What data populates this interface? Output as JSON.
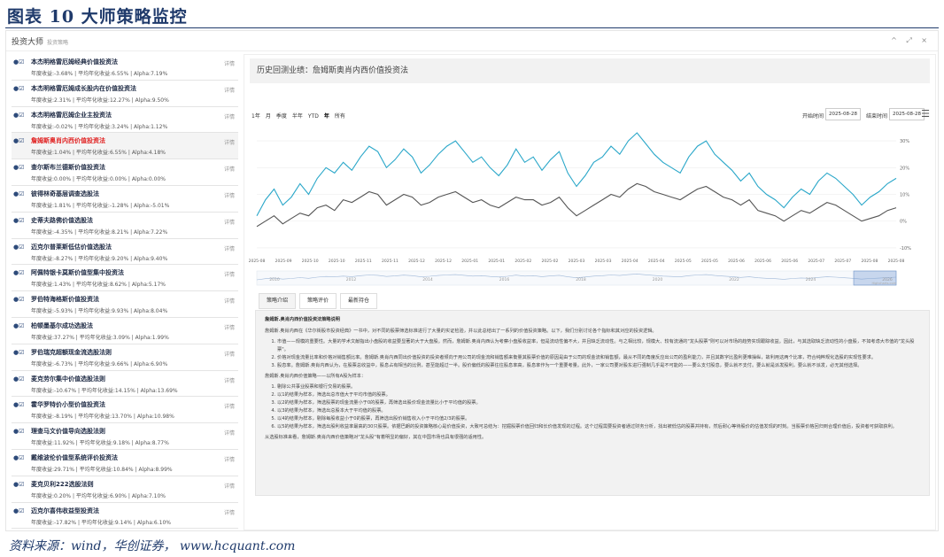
{
  "figure": {
    "title": "图表 10   大师策略监控",
    "source": "资料来源：wind，华创证券，  www.hcquant.com"
  },
  "app": {
    "name": "投资大师",
    "subtitle": "投资策略",
    "controls": "^ ⤢ ×"
  },
  "sidebar": {
    "action_label": "详情",
    "items": [
      {
        "name": "本杰明格雷厄姆经典价值投资法",
        "stats": "年度收益:-3.68% | 平均年化收益:6.55% | Alpha:7.19%"
      },
      {
        "name": "本杰明格雷厄姆成长股内在价值投资法",
        "stats": "年度收益:2.31% | 平均年化收益:12.27% | Alpha:9.50%"
      },
      {
        "name": "本杰明格雷厄姆企业主投资法",
        "stats": "年度收益:-0.02% | 平均年化收益:3.24% | Alpha:1.12%"
      },
      {
        "name": "詹姆斯奥肖内西价值投资法",
        "stats": "年度收益:1.04% | 平均年化收益:6.55% | Alpha:4.18%",
        "selected": true
      },
      {
        "name": "查尔斯布兰德斯价值投资法",
        "stats": "年度收益:0.00% | 平均年化收益:0.00% | Alpha:0.00%"
      },
      {
        "name": "彼得林奇基层调查选股法",
        "stats": "年度收益:1.81% | 平均年化收益:-1.28% | Alpha:-5.01%"
      },
      {
        "name": "史蒂夫路佛价值选股法",
        "stats": "年度收益:-4.35% | 平均年化收益:8.21% | Alpha:7.22%"
      },
      {
        "name": "迈克尔普莱斯低估价值选股法",
        "stats": "年度收益:-8.27% | 平均年化收益:9.20% | Alpha:9.40%"
      },
      {
        "name": "阿佩特银卡莫斯价值型集中投资法",
        "stats": "年度收益:1.43% | 平均年化收益:8.62% | Alpha:5.17%"
      },
      {
        "name": "罗伯特海格斯价值投资法",
        "stats": "年度收益:-5.93% | 平均年化收益:9.93% | Alpha:8.04%"
      },
      {
        "name": "柏顿墨基尔成功选股法",
        "stats": "年度收益:37.27% | 平均年化收益:3.09% | Alpha:1.99%"
      },
      {
        "name": "罗伯瑞克超额现金流选股法则",
        "stats": "年度收益:-6.73% | 平均年化收益:9.66% | Alpha:6.90%"
      },
      {
        "name": "麦克劳尔集中价值选股法则",
        "stats": "年度收益:-10.67% | 平均年化收益:14.15% | Alpha:13.69%"
      },
      {
        "name": "霍华罗特价小型价值投资法",
        "stats": "年度收益:-8.19% | 平均年化收益:13.70% | Alpha:10.98%"
      },
      {
        "name": "理查马文价值导向选股法则",
        "stats": "年度收益:11.92% | 平均年化收益:9.18% | Alpha:8.77%"
      },
      {
        "name": "戴维波伦价值型系统评价投资法",
        "stats": "年度收益:29.71% | 平均年化收益:10.84% | Alpha:8.99%"
      },
      {
        "name": "麦克贝利222选股法则",
        "stats": "年度收益:0.20% | 平均年化收益:6.90% | Alpha:7.10%"
      },
      {
        "name": "迈克尔喜伟收益型投资法",
        "stats": "年度收益:-17.82% | 平均年化收益:9.14% | Alpha:6.10%"
      }
    ]
  },
  "main": {
    "header": "历史回测业绩：詹姆斯奥肖内西价值投资法",
    "range_buttons": [
      "1年",
      "月",
      "季度",
      "半年",
      "YTD",
      "年",
      "所有"
    ],
    "active_range": "年",
    "start_label": "开始时间",
    "start_value": "2025-08-28",
    "end_label": "结束时间",
    "end_value": "2025-08-28",
    "menu_icon": "hamburger-icon",
    "tabs": [
      "策略介绍",
      "策略评价",
      "最新持仓"
    ],
    "active_tab": "策略介绍",
    "desc": {
      "title": "詹姆斯.奥肖内西价值投资法策略说明",
      "intro": "詹姆斯.奥肖内西在《华尔街股市投资经典》一书中，对不同的股票筛选标准进行了大量的实证检验，并以此总结出了一系列的价值投资策略。以下，我们分别讨论各个指标和其对应的投资逻辑。",
      "points1": [
        "市值——规模的重要性。大量的学术文献指出小盘股的收益要显著的大于大盘股。然而，詹姆斯.奥肖内西认为考察小盘股收益率，但是流动性偏不大，并且缺乏流动性。与之相比较，规模大、较有流通的\"龙头股票\"则可以对市场的趋势实现跟踪收益。因此，与其选取缺乏流动性的小盘股，不如考虑大市值的\"龙头股票\"。",
        "价格对现金流量比率和价格对销售额比率。詹姆斯.奥肖内西同出价值投资的投资者倾向于用公司的现金流和销售额来衡量其股票价值的原因是由于公司的现金流和销售额，最从不同的角度反应出公司的盈利能力，并且其数字比盈利更难操纵，故利用这两个比率，符合纯粹规化选股的实现性要求。",
        "股息率。詹姆斯.奥肖内西认为，在股票总收益中，股息占有相当的比例，甚至能超过一半。股价偏低的股票往往股息率高，股息率作为一个重要考量。此外，一家公司要对股东进行强制几乎是不可能的——要么支付股息，要么就不支付。要么就是派发股利，要么就不派发，必无其他选择。"
      ],
      "sub": "詹姆斯.奥肖内西价值策略——以所有A股为样本：",
      "points2": [
        "剔除公共事业股票和银行交易的股票。",
        "以1的结果为样本，筛选出总市值大于平均市值的股票。",
        "以2的结果为样本，筛选股票的现金流量小于0的股票，再筛选出股价现金流量比小于平均值的股票。",
        "以3的结果为样本，筛选出总股本大于平均值的股票。",
        "以4的结果为样本，剔除每股收益小于0的股票，再筛选出股价销售收入小于平均值2/3的股票。",
        "以5的结果为样本，筛选出股利收益率最高的30只股票。依据巴朗的投资策略核心是价值投资，大致可总结为：挖掘股票价值回归和长价值发现的过程。这个过程需要投资者通过财务分析，找出被低估的股票并持有，然后耐心等待股价的估值发现的时刻。当股票价格回归到合理价值后，投资者可获取获利。"
      ],
      "outro": "从选股标准来看，詹姆斯.奥肖内西价值策略对\"龙头股\"有着明显的偏好，其在中国市场也具有很强的适用性。"
    }
  },
  "chart_data": {
    "type": "line",
    "x_labels": [
      "2025-08",
      "2025-09",
      "2025-10",
      "2025-11",
      "2025-12",
      "2025-01",
      "2025-02",
      "2025-03",
      "2025-04",
      "2025-05",
      "2025-06",
      "2025-07",
      "2025-08"
    ],
    "x_tick_labels": [
      "2025-08",
      "2025-09",
      "2025-10",
      "2025-10",
      "2025-11",
      "2025-11",
      "2025-12",
      "2025-12",
      "2025-01",
      "2025-01",
      "2025-02",
      "2025-02",
      "2025-03",
      "2025-03",
      "2025-04",
      "2025-04",
      "2025-05",
      "2025-05",
      "2025-06",
      "2025-06",
      "2025-06",
      "2025-07",
      "2025-07",
      "2025-08",
      "2025-08"
    ],
    "y_tick_labels": [
      "30%",
      "20%",
      "10%",
      "0%",
      "-10%"
    ],
    "ylim": [
      -12,
      35
    ],
    "series": [
      {
        "color": "#2aa7c9",
        "values": [
          2,
          8,
          12,
          6,
          9,
          14,
          10,
          16,
          20,
          18,
          22,
          19,
          24,
          28,
          26,
          20,
          23,
          27,
          24,
          18,
          21,
          25,
          28,
          30,
          26,
          22,
          24,
          20,
          17,
          21,
          27,
          22,
          24,
          19,
          23,
          26,
          18,
          13,
          17,
          22,
          24,
          28,
          25,
          30,
          33,
          29,
          25,
          22,
          20,
          18,
          24,
          28,
          30,
          25,
          22,
          19,
          15,
          18,
          13,
          10,
          8,
          5,
          9,
          12,
          10,
          15,
          18,
          16,
          13,
          10,
          6,
          9,
          11,
          14,
          16
        ]
      },
      {
        "color": "#555555",
        "values": [
          -2,
          0,
          2,
          -1,
          1,
          3,
          2,
          5,
          6,
          4,
          8,
          7,
          9,
          11,
          10,
          6,
          8,
          10,
          9,
          6,
          7,
          9,
          10,
          11,
          9,
          7,
          8,
          6,
          5,
          7,
          9,
          8,
          8,
          6,
          7,
          9,
          5,
          2,
          4,
          6,
          8,
          10,
          9,
          12,
          14,
          13,
          11,
          10,
          9,
          8,
          10,
          12,
          13,
          11,
          9,
          8,
          6,
          8,
          4,
          3,
          2,
          0,
          2,
          4,
          3,
          5,
          7,
          6,
          4,
          2,
          0,
          1,
          2,
          4,
          5
        ]
      }
    ],
    "navigator_labels": [
      "2010",
      "2012",
      "2014",
      "2016",
      "2018",
      "2020",
      "2022",
      "2024",
      "2026"
    ],
    "navigator_credit": "Highcharts.com"
  }
}
